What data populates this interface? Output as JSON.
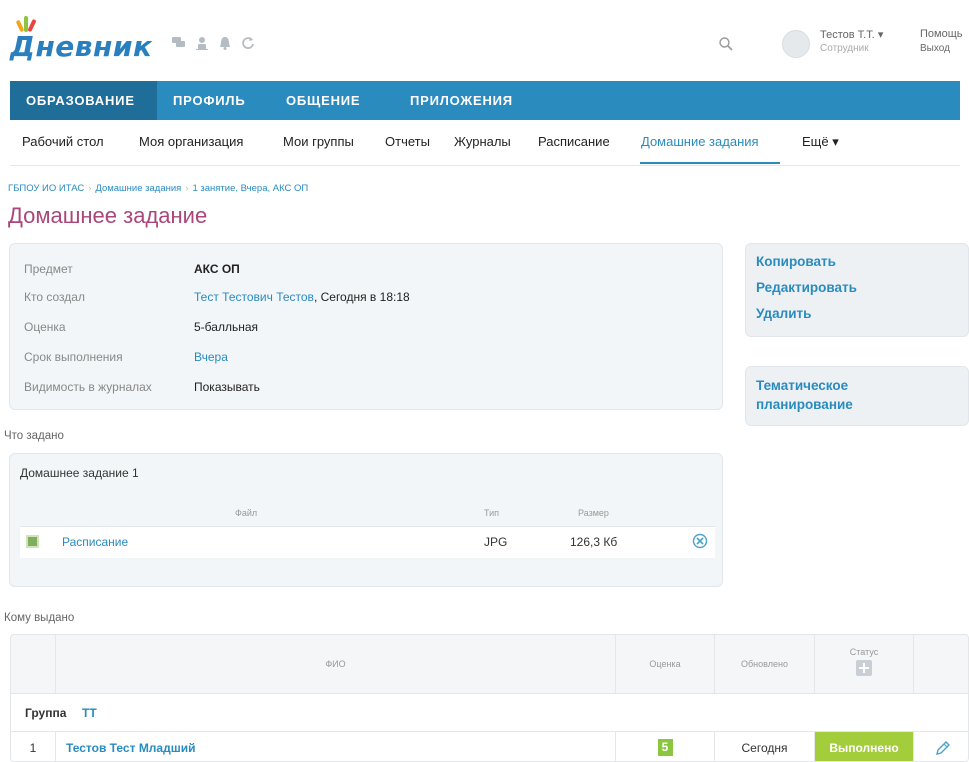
{
  "header": {
    "logo_text": "Дневник",
    "user": {
      "name": "Тестов Т.Т. ▾",
      "role": "Сотрудник"
    },
    "help_label": "Помощь",
    "logout_label": "Выход",
    "icons": [
      "chat-icon",
      "person-icon",
      "bell-icon",
      "refresh-icon"
    ],
    "brand_color": "#2a8bbf"
  },
  "main_nav": {
    "tabs": [
      {
        "label": "ОБРАЗОВАНИЕ",
        "active": true
      },
      {
        "label": "ПРОФИЛЬ",
        "active": false
      },
      {
        "label": "ОБЩЕНИЕ",
        "active": false
      },
      {
        "label": "ПРИЛОЖЕНИЯ",
        "active": false
      }
    ]
  },
  "sub_nav": {
    "items": [
      {
        "label": "Рабочий стол"
      },
      {
        "label": "Моя организация"
      },
      {
        "label": "Мои группы"
      },
      {
        "label": "Отчеты"
      },
      {
        "label": "Журналы"
      },
      {
        "label": "Расписание"
      },
      {
        "label": "Домашние задания",
        "active": true
      },
      {
        "label": "Ещё ▾"
      }
    ]
  },
  "breadcrumb": {
    "items": [
      "ГБПОУ ИО ИТАС",
      "Домашние задания",
      "1 занятие, Вчера, АКС ОП"
    ]
  },
  "page_title": "Домашнее задание",
  "info": {
    "subject": {
      "label": "Предмет",
      "value": "АКС ОП"
    },
    "creator": {
      "label": "Кто создал",
      "value": "Тест Тестович Тестов",
      "suffix": ", Сегодня в 18:18"
    },
    "grade": {
      "label": "Оценка",
      "value": "5-балльная"
    },
    "deadline": {
      "label": "Срок выполнения",
      "value": "Вчера"
    },
    "visibility": {
      "label": "Видимость в журналах",
      "value": "Показывать"
    }
  },
  "actions": {
    "copy": "Копировать",
    "edit": "Редактировать",
    "delete": "Удалить",
    "thematic": "Тематическое планирование"
  },
  "assigned": {
    "section_label": "Что задано",
    "homework_title": "Домашнее задание 1",
    "columns": {
      "file": "Файл",
      "type": "Тип",
      "size": "Размер"
    },
    "files": [
      {
        "name": "Расписание",
        "type": "JPG",
        "size": "126,3 Кб"
      }
    ]
  },
  "issued": {
    "section_label": "Кому выдано",
    "columns": {
      "name": "ФИО",
      "grade": "Оценка",
      "updated": "Обновлено",
      "status": "Статус"
    },
    "group_prefix": "Группа",
    "group_name": "ТТ",
    "rows": [
      {
        "num": "1",
        "name": "Тестов Тест Младший",
        "grade": "5",
        "updated": "Сегодня",
        "status": "Выполнено"
      }
    ]
  }
}
